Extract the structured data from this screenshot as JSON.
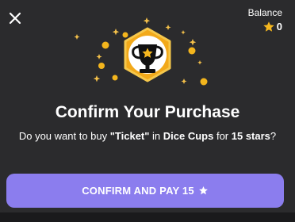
{
  "header": {
    "close_icon": "close-icon",
    "balance_label": "Balance",
    "balance_value": "0",
    "balance_icon": "star-icon"
  },
  "hero": {
    "icon": "trophy-icon",
    "badge_color": "#f2a91a",
    "decorations": "sparkle-stars-and-coins"
  },
  "dialog": {
    "title": "Confirm Your Purchase",
    "desc_prefix": "Do you want to buy ",
    "item_name": "\"Ticket\"",
    "desc_in": " in ",
    "app_name": "Dice Cups",
    "desc_for": " for ",
    "price_text": "15 stars",
    "desc_suffix": "?"
  },
  "confirm_button": {
    "label": "CONFIRM AND PAY 15",
    "icon": "star-icon",
    "color": "#8b7dee"
  }
}
